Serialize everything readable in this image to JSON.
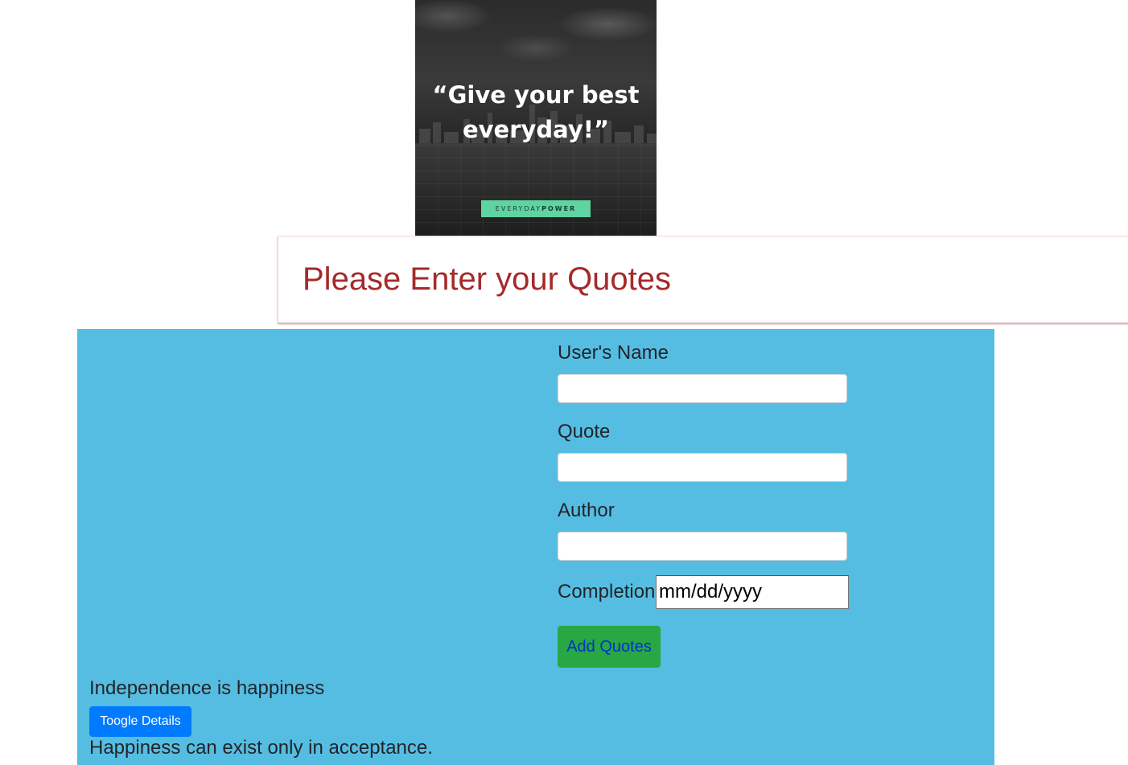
{
  "banner": {
    "quote_line1": "“Give your best",
    "quote_line2": "everyday!”",
    "brand_light": "EVERYDAY",
    "brand_bold": "POWER",
    "brand_color": "#5fd3a0"
  },
  "header": {
    "title": "Please Enter your Quotes",
    "title_color": "#a52a2a"
  },
  "form": {
    "name_label": "User's Name",
    "name_value": "",
    "quote_label": "Quote",
    "quote_value": "",
    "author_label": "Author",
    "author_value": "",
    "completion_label": "Completion",
    "completion_placeholder": "mm/dd/yyyy",
    "submit_label": "Add Quotes",
    "panel_color": "#56bde2",
    "submit_color": "#28a745"
  },
  "quotes": [
    {
      "text": "Independence is happiness",
      "toggle_label": "Toogle Details"
    },
    {
      "text": "Happiness can exist only in acceptance."
    }
  ],
  "toggle_color": "#007bff"
}
